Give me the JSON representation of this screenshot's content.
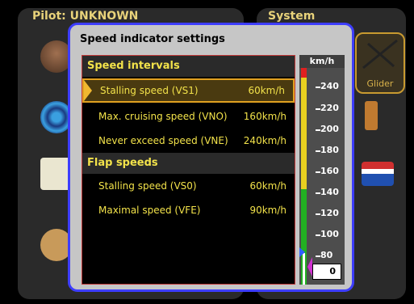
{
  "background": {
    "pilot_title": "Pilot: UNKNOWN",
    "system_title": "System",
    "glider_label": "Glider"
  },
  "dialog": {
    "title": "Speed indicator settings",
    "sections": [
      {
        "label": "Speed intervals",
        "items": [
          {
            "label": "Stalling speed (VS1)",
            "value": "60km/h",
            "selected": true
          },
          {
            "label": "Max. cruising speed (VNO)",
            "value": "160km/h",
            "selected": false
          },
          {
            "label": "Never exceed speed (VNE)",
            "value": "240km/h",
            "selected": false
          }
        ]
      },
      {
        "label": "Flap speeds",
        "items": [
          {
            "label": "Stalling speed (VS0)",
            "value": "60km/h",
            "selected": false
          },
          {
            "label": "Maximal speed (VFE)",
            "value": "90km/h",
            "selected": false
          }
        ]
      }
    ]
  },
  "scale": {
    "unit": "km/h",
    "ticks": [
      "240",
      "220",
      "200",
      "180",
      "160",
      "140",
      "120",
      "100",
      "80"
    ],
    "current_value": "0"
  },
  "colors": {
    "dialog_border": "#3d3dff",
    "accent_yellow": "#f2e24a",
    "selection": "#e0a020",
    "green_arc": "#22b022",
    "yellow_arc": "#e8d020",
    "red_line": "#e02020"
  }
}
